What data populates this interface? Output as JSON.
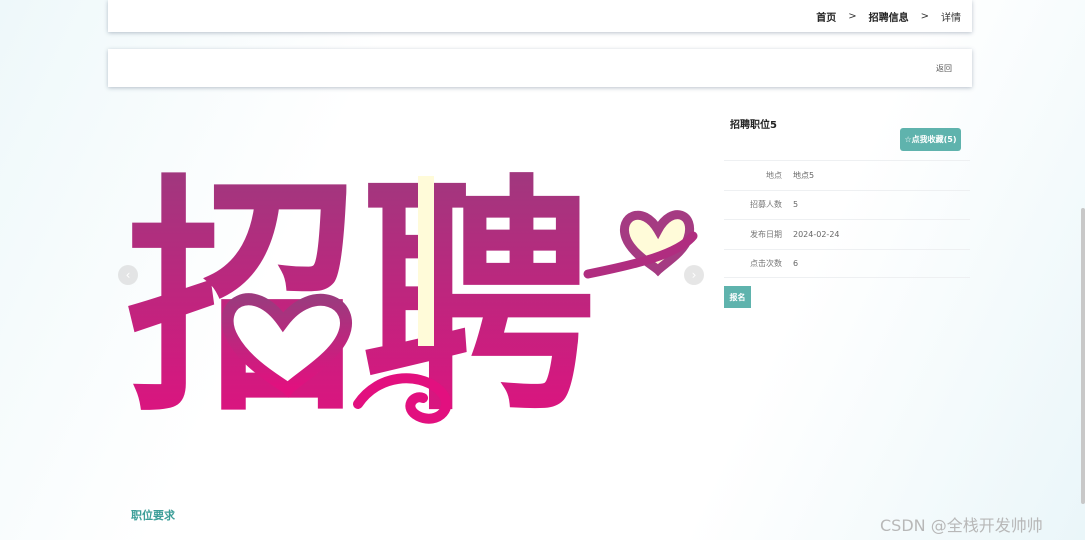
{
  "breadcrumb": {
    "home": "首页",
    "sep": ">",
    "section": "招聘信息",
    "current": "详情"
  },
  "back_label": "返回",
  "banner_text": "招聘",
  "job": {
    "title": "招聘职位5",
    "favorite_label": "☆点我收藏(5)",
    "fields": [
      {
        "label": "地点",
        "value": "地点5"
      },
      {
        "label": "招募人数",
        "value": "5"
      },
      {
        "label": "发布日期",
        "value": "2024-02-24"
      },
      {
        "label": "点击次数",
        "value": "6"
      }
    ],
    "apply_label": "报名"
  },
  "section_heading": "职位要求",
  "watermark": "CSDN @全栈开发帅帅",
  "colors": {
    "accent": "#5fb3ad",
    "banner_top": "#9c3a7e",
    "banner_bottom": "#e2107f"
  }
}
